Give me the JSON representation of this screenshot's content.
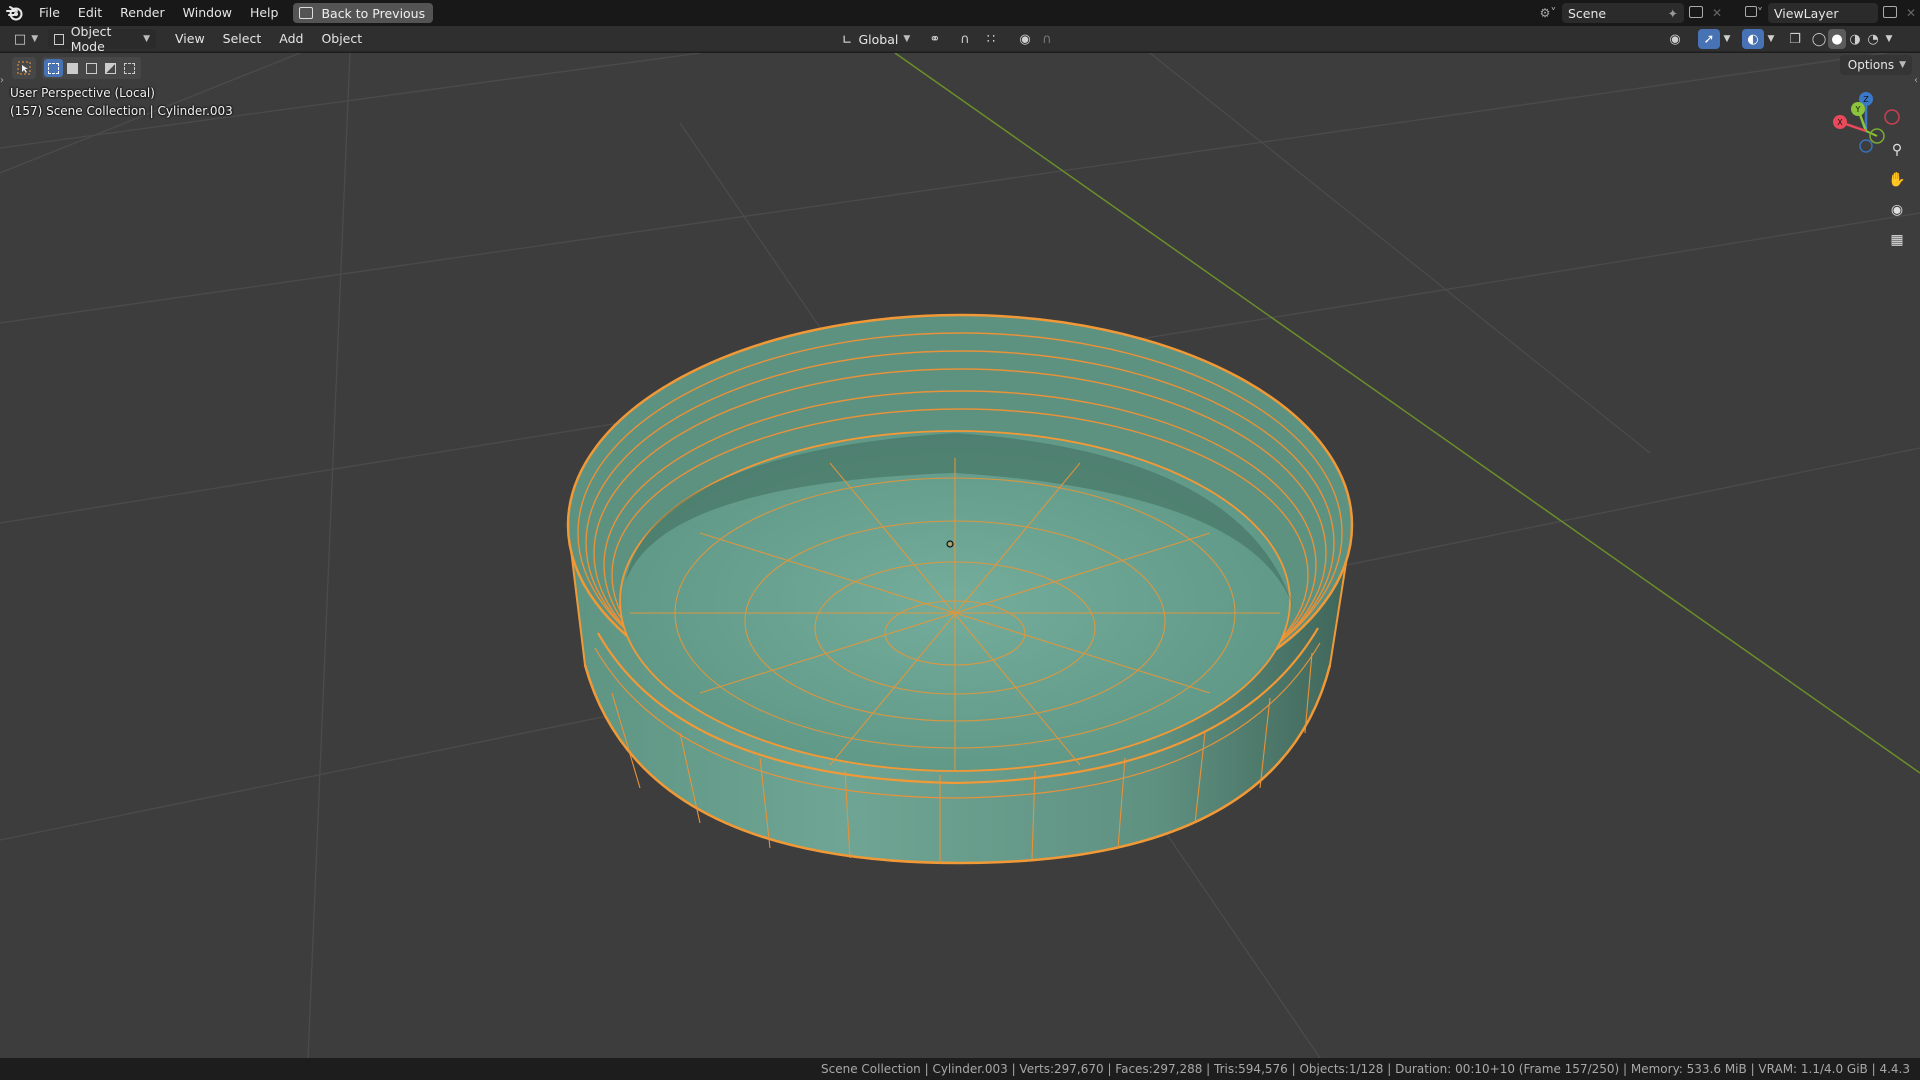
{
  "topbar": {
    "menus": [
      "File",
      "Edit",
      "Render",
      "Window",
      "Help"
    ],
    "back_button": "Back to Previous",
    "scene_field": "Scene",
    "viewlayer_field": "ViewLayer"
  },
  "header": {
    "mode": "Object Mode",
    "menus": [
      "View",
      "Select",
      "Add",
      "Object"
    ],
    "transform_orientation": "Global"
  },
  "viewport": {
    "perspective_label": "User Perspective (Local)",
    "collection_label": "(157) Scene Collection | Cylinder.003",
    "options_label": "Options",
    "gizmo_axes": {
      "x": "X",
      "y": "Y",
      "z": "Z"
    }
  },
  "statusbar": {
    "text": "Scene Collection | Cylinder.003 | Verts:297,670 | Faces:297,288 | Tris:594,576 | Objects:1/128 | Duration: 00:10+10 (Frame 157/250) | Memory: 533.6 MiB | VRAM: 1.1/4.0 GiB | 4.4.3"
  },
  "colors": {
    "viewport_bg": "#3d3d3d",
    "grid_line": "#4a4a4a",
    "y_axis_line": "#6a8f2a",
    "selection_outline": "#f19936",
    "mesh_fill": "#6ea392",
    "accent": "#4772b3"
  },
  "icons": [
    "blender-logo",
    "back-window-icon",
    "scene-icon",
    "pin-icon",
    "copy-icon",
    "close-icon",
    "viewlayer-icon",
    "editor-type-icon",
    "object-mode-icon",
    "orientation-icon",
    "pivot-icon",
    "snap-icon",
    "snap-increment-icon",
    "proportional-icon",
    "visibility-icon",
    "gizmo-icon",
    "overlay-icon",
    "xray-icon",
    "wireframe-icon",
    "solid-icon",
    "material-icon",
    "rendered-icon",
    "zoom-icon",
    "hand-icon",
    "camera-icon",
    "grid-icon"
  ]
}
